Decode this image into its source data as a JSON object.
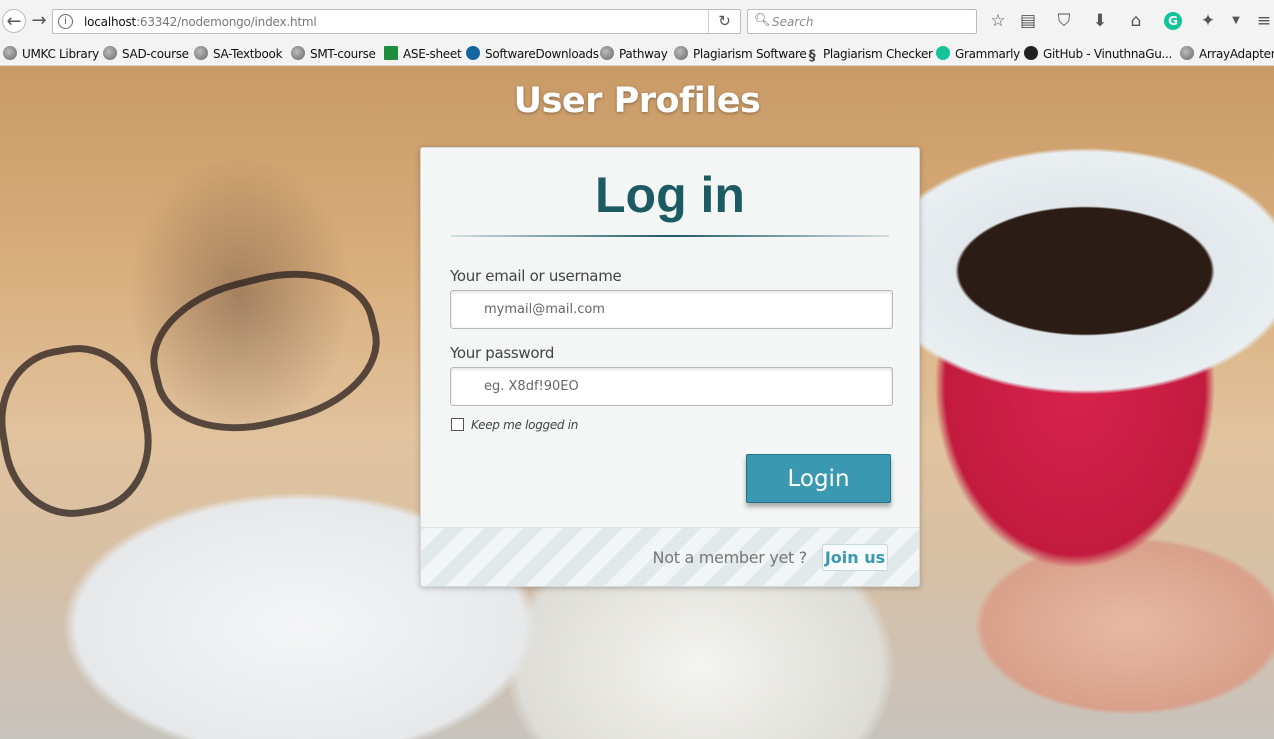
{
  "browser": {
    "url_host": "localhost",
    "url_rest": ":63342/nodemongo/index.html",
    "search_placeholder": "Search",
    "bookmarks": [
      {
        "label": "UMKC Library",
        "icon": "globe-icon"
      },
      {
        "label": "SAD-course",
        "icon": "globe-icon"
      },
      {
        "label": "SA-Textbook",
        "icon": "globe-icon"
      },
      {
        "label": "SMT-course",
        "icon": "globe-icon"
      },
      {
        "label": "ASE-sheet",
        "icon": "sheets-icon"
      },
      {
        "label": "SoftwareDownloads",
        "icon": "otn-icon"
      },
      {
        "label": "Pathway",
        "icon": "globe-icon"
      },
      {
        "label": "Plagiarism Software",
        "icon": "globe-icon"
      },
      {
        "label": "Plagiarism Checker",
        "icon": "ss-icon"
      },
      {
        "label": "Grammarly",
        "icon": "grammarly-icon"
      },
      {
        "label": "GitHub - VinuthnaGu...",
        "icon": "github-icon"
      },
      {
        "label": "ArrayAdapter",
        "icon": "globe-icon"
      }
    ]
  },
  "page": {
    "heading": "User Profiles",
    "login": {
      "title": "Log in",
      "email_label": "Your email or username",
      "email_placeholder": "mymail@mail.com",
      "password_label": "Your password",
      "password_placeholder": "eg. X8df!90EO",
      "keep_label": "Keep me logged in",
      "button_label": "Login",
      "footer_text": "Not a member yet ?",
      "join_label": "Join us"
    }
  },
  "colors": {
    "accent": "#3a99b0",
    "title": "#1d5b63"
  }
}
